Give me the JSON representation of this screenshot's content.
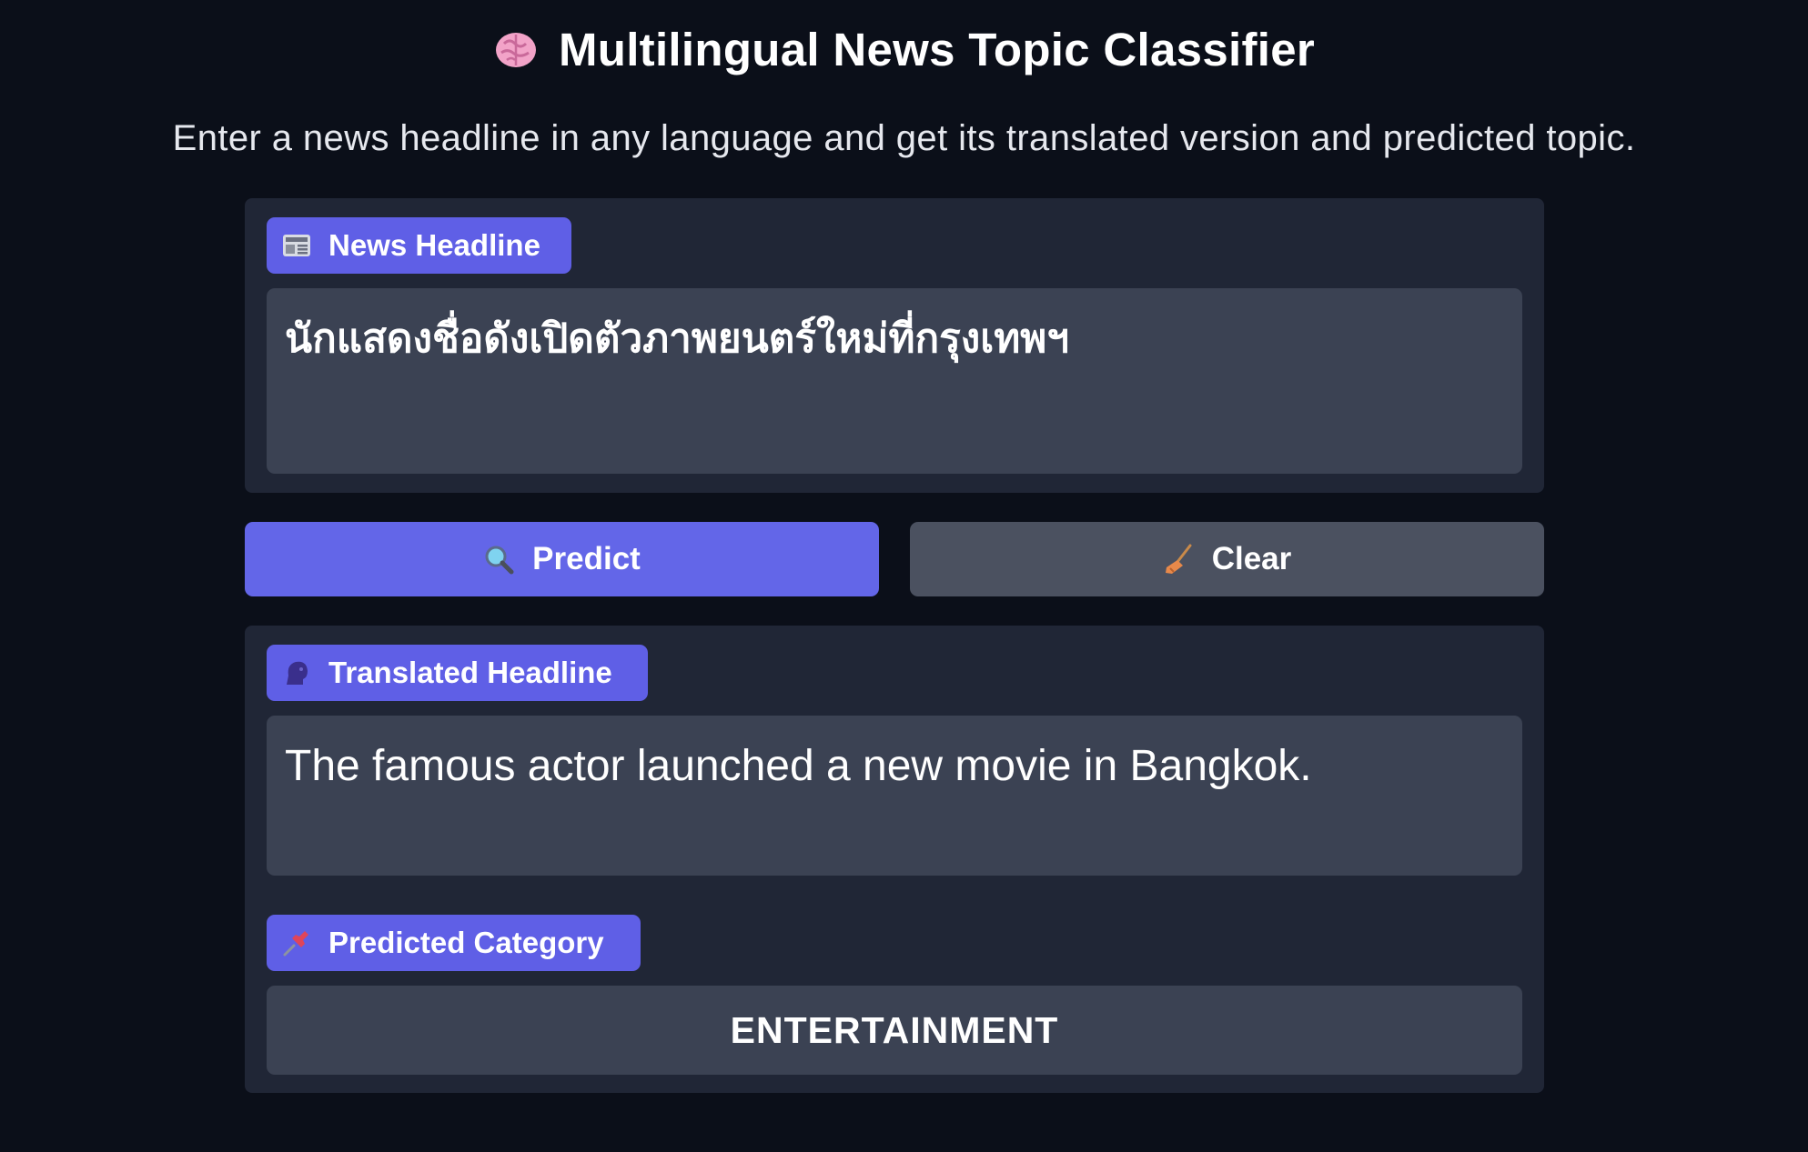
{
  "header": {
    "title": "Multilingual News Topic Classifier",
    "title_icon": "brain-icon",
    "subtitle": "Enter a news headline in any language and get its translated version and predicted topic."
  },
  "input_panel": {
    "label": "News Headline",
    "label_icon": "newspaper-icon",
    "value": "นักแสดงชื่อดังเปิดตัวภาพยนตร์ใหม่ที่กรุงเทพฯ"
  },
  "buttons": {
    "predict_label": "Predict",
    "predict_icon": "magnifier-icon",
    "clear_label": "Clear",
    "clear_icon": "broom-icon"
  },
  "output_panel": {
    "translated_label": "Translated Headline",
    "translated_icon": "speaking-head-icon",
    "translated_value": "The famous actor launched a new movie in Bangkok.",
    "category_label": "Predicted Category",
    "category_icon": "pushpin-icon",
    "category_value": "ENTERTAINMENT"
  },
  "colors": {
    "background": "#0b0f19",
    "panel": "#202636",
    "field": "#3b4253",
    "accent": "#6366e8",
    "secondary_button": "#4b5160"
  }
}
